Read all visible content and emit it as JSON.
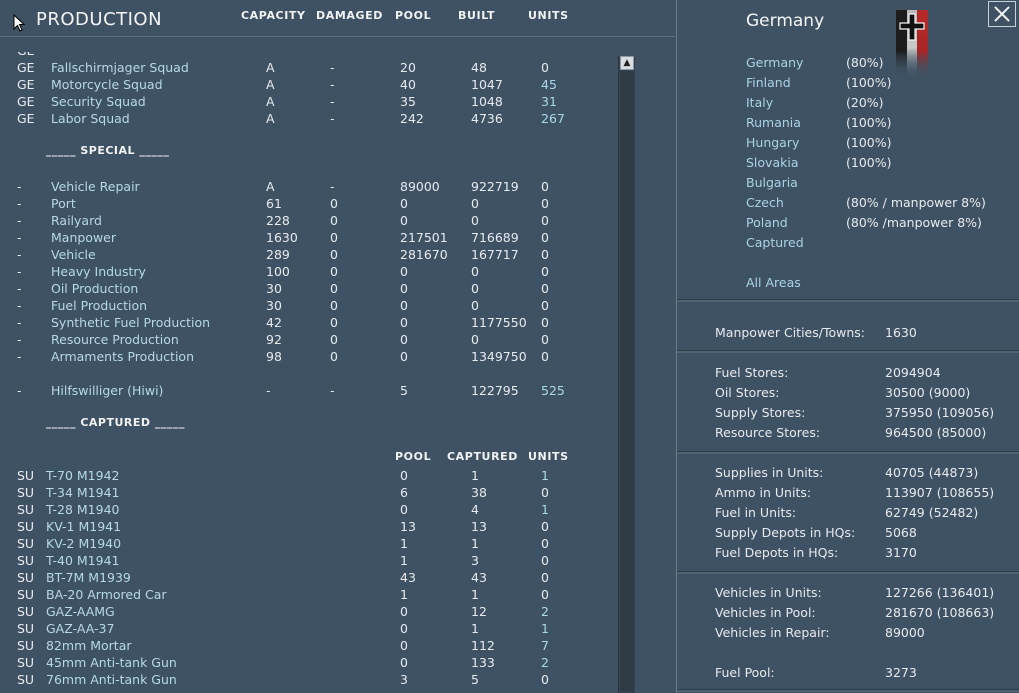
{
  "header": {
    "title": "PRODUCTION",
    "columns": [
      "CAPACITY",
      "DAMAGED",
      "POOL",
      "BUILT",
      "UNITS"
    ]
  },
  "units_rows": [
    {
      "pre": "GE",
      "name": "Fallschirmjager Squad",
      "cap": "A",
      "dmg": "-",
      "pool": "20",
      "built": "48",
      "units": "0"
    },
    {
      "pre": "GE",
      "name": "Motorcycle Squad",
      "cap": "A",
      "dmg": "-",
      "pool": "40",
      "built": "1047",
      "units": "45"
    },
    {
      "pre": "GE",
      "name": "Security Squad",
      "cap": "A",
      "dmg": "-",
      "pool": "35",
      "built": "1048",
      "units": "31"
    },
    {
      "pre": "GE",
      "name": "Labor Squad",
      "cap": "A",
      "dmg": "-",
      "pool": "242",
      "built": "4736",
      "units": "267"
    }
  ],
  "special": {
    "title": "_____ SPECIAL _____",
    "rows": [
      {
        "pre": "-",
        "name": "Vehicle Repair",
        "cap": "A",
        "dmg": "-",
        "pool": "89000",
        "built": "922719",
        "units": "0"
      },
      {
        "pre": "-",
        "name": "Port",
        "cap": "61",
        "dmg": "0",
        "pool": "0",
        "built": "0",
        "units": "0"
      },
      {
        "pre": "-",
        "name": "Railyard",
        "cap": "228",
        "dmg": "0",
        "pool": "0",
        "built": "0",
        "units": "0"
      },
      {
        "pre": "-",
        "name": "Manpower",
        "cap": "1630",
        "dmg": "0",
        "pool": "217501",
        "built": "716689",
        "units": "0"
      },
      {
        "pre": "-",
        "name": "Vehicle",
        "cap": "289",
        "dmg": "0",
        "pool": "281670",
        "built": "167717",
        "units": "0"
      },
      {
        "pre": "-",
        "name": "Heavy Industry",
        "cap": "100",
        "dmg": "0",
        "pool": "0",
        "built": "0",
        "units": "0"
      },
      {
        "pre": "-",
        "name": "Oil Production",
        "cap": "30",
        "dmg": "0",
        "pool": "0",
        "built": "0",
        "units": "0"
      },
      {
        "pre": "-",
        "name": "Fuel Production",
        "cap": "30",
        "dmg": "0",
        "pool": "0",
        "built": "0",
        "units": "0"
      },
      {
        "pre": "-",
        "name": "Synthetic Fuel Production",
        "cap": "42",
        "dmg": "0",
        "pool": "0",
        "built": "1177550",
        "units": "0"
      },
      {
        "pre": "-",
        "name": "Resource Production",
        "cap": "92",
        "dmg": "0",
        "pool": "0",
        "built": "0",
        "units": "0"
      },
      {
        "pre": "-",
        "name": "Armaments Production",
        "cap": "98",
        "dmg": "0",
        "pool": "0",
        "built": "1349750",
        "units": "0"
      }
    ],
    "hiwi": {
      "pre": "-",
      "name": "Hilfswilliger (Hiwi)",
      "cap": "-",
      "dmg": "-",
      "pool": "5",
      "built": "122795",
      "units": "525"
    }
  },
  "captured": {
    "title": "_____ CAPTURED _____",
    "columns": [
      "POOL",
      "CAPTURED",
      "UNITS"
    ],
    "rows": [
      {
        "pre": "SU",
        "name": "T-70 M1942",
        "pool": "0",
        "captured": "1",
        "units": "1"
      },
      {
        "pre": "SU",
        "name": "T-34 M1941",
        "pool": "6",
        "captured": "38",
        "units": "0"
      },
      {
        "pre": "SU",
        "name": "T-28 M1940",
        "pool": "0",
        "captured": "4",
        "units": "1"
      },
      {
        "pre": "SU",
        "name": "KV-1 M1941",
        "pool": "13",
        "captured": "13",
        "units": "0"
      },
      {
        "pre": "SU",
        "name": "KV-2 M1940",
        "pool": "1",
        "captured": "1",
        "units": "0"
      },
      {
        "pre": "SU",
        "name": "T-40 M1941",
        "pool": "1",
        "captured": "3",
        "units": "0"
      },
      {
        "pre": "SU",
        "name": "BT-7M M1939",
        "pool": "43",
        "captured": "43",
        "units": "0"
      },
      {
        "pre": "SU",
        "name": "BA-20 Armored Car",
        "pool": "1",
        "captured": "1",
        "units": "0"
      },
      {
        "pre": "SU",
        "name": "GAZ-AAMG",
        "pool": "0",
        "captured": "12",
        "units": "2"
      },
      {
        "pre": "SU",
        "name": "GAZ-AA-37",
        "pool": "0",
        "captured": "1",
        "units": "1"
      },
      {
        "pre": "SU",
        "name": "82mm Mortar",
        "pool": "0",
        "captured": "112",
        "units": "7"
      },
      {
        "pre": "SU",
        "name": "45mm Anti-tank Gun",
        "pool": "0",
        "captured": "133",
        "units": "2"
      },
      {
        "pre": "SU",
        "name": "76mm Anti-tank Gun",
        "pool": "3",
        "captured": "5",
        "units": "0"
      }
    ]
  },
  "panel": {
    "country": "Germany",
    "areas": [
      {
        "name": "Germany",
        "pct": "(80%)"
      },
      {
        "name": "Finland",
        "pct": "(100%)"
      },
      {
        "name": "Italy",
        "pct": "(20%)"
      },
      {
        "name": "Rumania",
        "pct": "(100%)"
      },
      {
        "name": "Hungary",
        "pct": "(100%)"
      },
      {
        "name": "Slovakia",
        "pct": "(100%)"
      },
      {
        "name": "Bulgaria",
        "pct": ""
      },
      {
        "name": "Czech",
        "pct": "(80% / manpower 8%)"
      },
      {
        "name": "Poland",
        "pct": "(80% /manpower 8%)"
      },
      {
        "name": "Captured",
        "pct": ""
      }
    ],
    "all_areas": "All Areas",
    "manpower": [
      {
        "label": "Manpower Cities/Towns:",
        "value": "1630"
      }
    ],
    "stores": [
      {
        "label": "Fuel Stores:",
        "value": "2094904"
      },
      {
        "label": "Oil Stores:",
        "value": "30500 (9000)"
      },
      {
        "label": "Supply Stores:",
        "value": "375950 (109056)"
      },
      {
        "label": "Resource Stores:",
        "value": "964500 (85000)"
      }
    ],
    "units": [
      {
        "label": "Supplies in Units:",
        "value": "40705 (44873)"
      },
      {
        "label": "Ammo in Units:",
        "value": "113907 (108655)"
      },
      {
        "label": "Fuel in Units:",
        "value": "62749 (52482)"
      },
      {
        "label": "Supply Depots in HQs:",
        "value": "5068"
      },
      {
        "label": "Fuel Depots in HQs:",
        "value": "3170"
      }
    ],
    "vehicles": [
      {
        "label": "Vehicles in Units:",
        "value": "127266 (136401)"
      },
      {
        "label": "Vehicles in Pool:",
        "value": "281670 (108663)"
      },
      {
        "label": "Vehicles in Repair:",
        "value": "89000"
      }
    ],
    "fuel_pool": {
      "label": "Fuel Pool:",
      "value": "3273"
    }
  }
}
